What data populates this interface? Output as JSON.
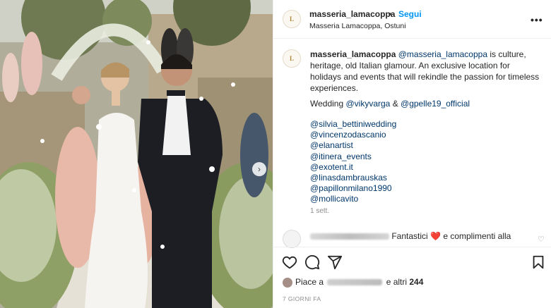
{
  "post": {
    "username": "masseria_lamacoppa",
    "separator": "•",
    "follow_label": "Segui",
    "location": "Masseria Lamacoppa, Ostuni",
    "more_icon": "more-horizontal-icon",
    "avatar_logo": "L"
  },
  "caption": {
    "username": "masseria_lamacoppa",
    "mention": "@masseria_lamacoppa",
    "text": " is culture, heritage, old Italian glamour. An exclusive location for holidays and events that will rekindle the passion for timeless experiences.",
    "wedding_label": "Wedding ",
    "wedding_mention_1": "@vikyvarga",
    "wedding_and": " & ",
    "wedding_mention_2": "@gpelle19_official",
    "credits": [
      "@silvia_bettiniwedding",
      "@vincenzodascanio",
      "@elanartist",
      "@itinera_events",
      "@exotent.it",
      "@linasdambrauskas",
      "@papillonmilano1990",
      "@mollicavito"
    ],
    "time_relative": "1 sett."
  },
  "comment": {
    "text_before": " Fantastici ",
    "heart": "❤️",
    "text_after": " e complimenti alla"
  },
  "actions": {
    "like_icon": "heart-outline-icon",
    "comment_icon": "comment-icon",
    "share_icon": "send-icon",
    "save_icon": "bookmark-icon"
  },
  "likes": {
    "prefix": "Piace a ",
    "suffix": " e altri ",
    "count": "244"
  },
  "date": "7 GIORNI FA",
  "colors": {
    "link": "#00376b",
    "follow": "#0095f6",
    "muted": "#8e8e8e",
    "heart": "#e0245e"
  }
}
